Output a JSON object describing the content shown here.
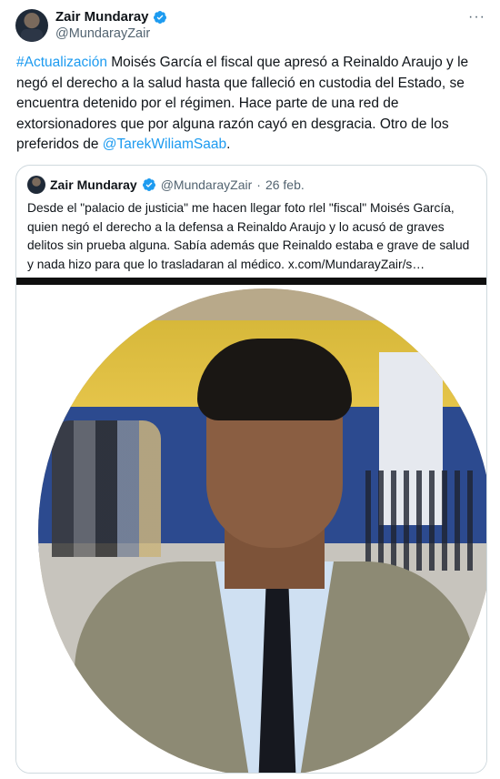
{
  "post": {
    "author_name": "Zair Mundaray",
    "author_handle": "@MundarayZair",
    "more_label": "···",
    "hashtag": "#Actualización",
    "text_part1": " Moisés García el fiscal que apresó a Reinaldo Araujo y le negó el derecho a la salud hasta que falleció en custodia del Estado, se encuentra detenido por el régimen. Hace parte de una red de extorsionadores que por alguna razón cayó en desgracia. Otro de los preferidos de ",
    "mention": "@TarekWiliamSaab",
    "text_part2": "."
  },
  "quote": {
    "author_name": "Zair Mundaray",
    "author_handle": "@MundarayZair",
    "separator": "·",
    "date": "26 feb.",
    "text": "Desde el \"palacio de justicia\" me hacen llegar foto rlel \"fiscal\" Moisés García, quien negó el derecho a la defensa a Reinaldo Araujo y lo acusó de graves delitos sin prueba alguna. Sabía además que Reinaldo estaba e grave de salud y nada hizo para que lo trasladaran al médico.  x.com/MundarayZair/s…"
  },
  "colors": {
    "link": "#1d9bf0",
    "verified": "#1d9bf0",
    "secondary_text": "#536471"
  },
  "icons": {
    "verified": "verified-badge-icon",
    "more": "more-options-icon"
  }
}
